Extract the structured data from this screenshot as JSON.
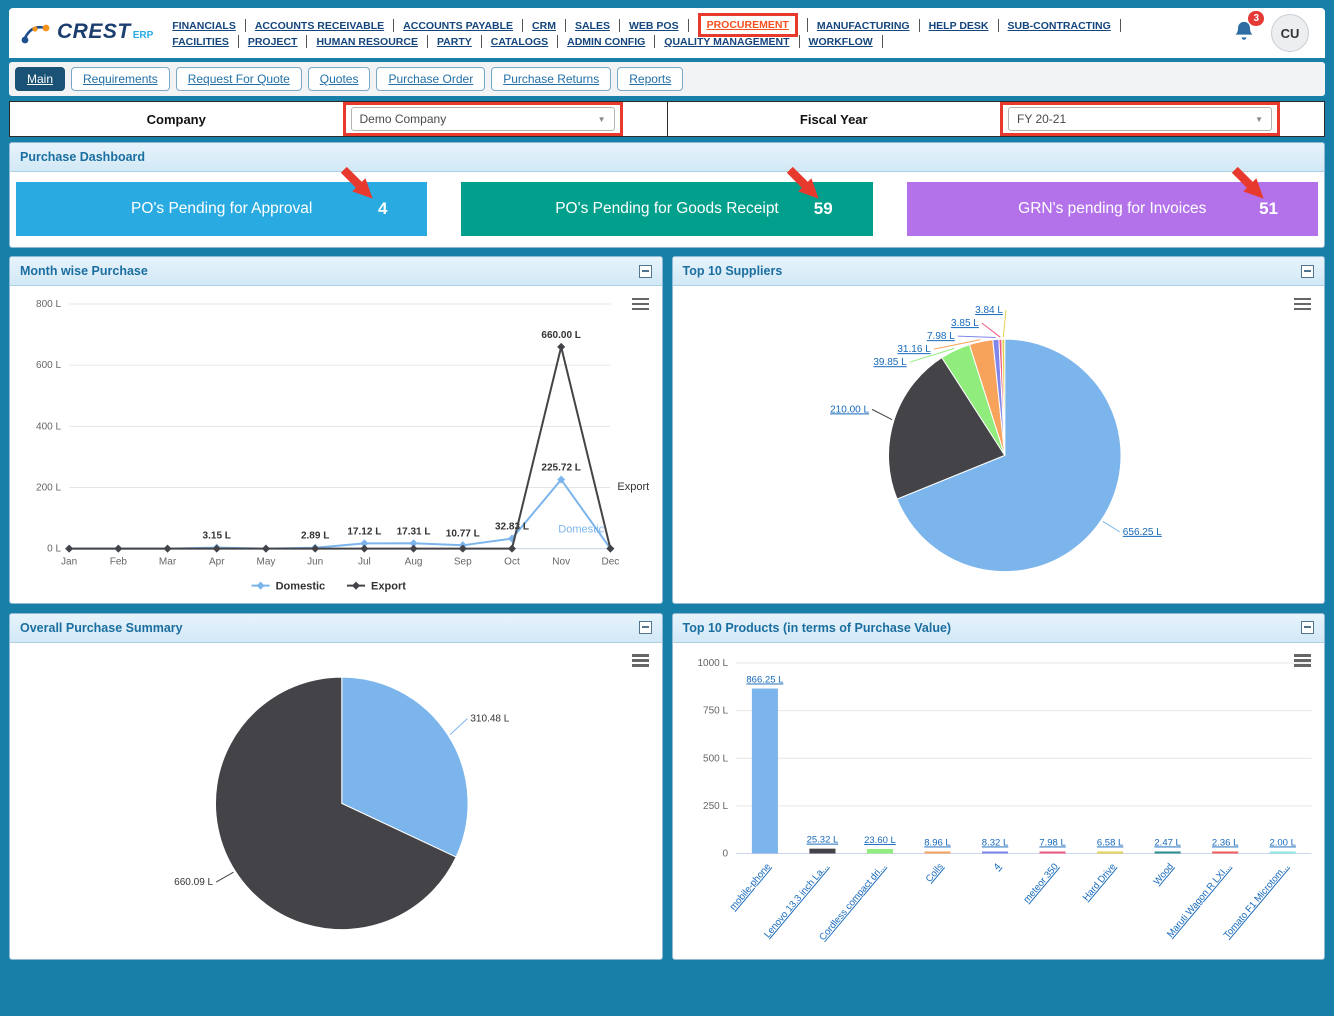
{
  "brand": {
    "name": "CREST",
    "suffix": "ERP"
  },
  "header": {
    "nav_row1": [
      {
        "label": "FINANCIALS"
      },
      {
        "label": "ACCOUNTS RECEIVABLE"
      },
      {
        "label": "ACCOUNTS PAYABLE"
      },
      {
        "label": "CRM"
      },
      {
        "label": "SALES"
      },
      {
        "label": "WEB POS"
      },
      {
        "label": "PROCUREMENT",
        "active": true,
        "highlighted": true
      },
      {
        "label": "MANUFACTURING"
      },
      {
        "label": "HELP DESK"
      },
      {
        "label": "SUB-CONTRACTING"
      }
    ],
    "nav_row2": [
      {
        "label": "FACILITIES"
      },
      {
        "label": "PROJECT"
      },
      {
        "label": "HUMAN RESOURCE"
      },
      {
        "label": "PARTY"
      },
      {
        "label": "CATALOGS"
      },
      {
        "label": "ADMIN CONFIG"
      },
      {
        "label": "QUALITY MANAGEMENT"
      },
      {
        "label": "WORKFLOW"
      }
    ],
    "notification_count": "3",
    "avatar_initials": "CU"
  },
  "tabs": [
    {
      "label": "Main",
      "active": true
    },
    {
      "label": "Requirements"
    },
    {
      "label": "Request For Quote"
    },
    {
      "label": "Quotes"
    },
    {
      "label": "Purchase Order"
    },
    {
      "label": "Purchase Returns"
    },
    {
      "label": "Reports"
    }
  ],
  "filters": {
    "company": {
      "label": "Company",
      "value": "Demo Company"
    },
    "fiscal_year": {
      "label": "Fiscal Year",
      "value": "FY 20-21"
    }
  },
  "dashboard_title": "Purchase Dashboard",
  "kpis": [
    {
      "label": "PO's Pending for Approval",
      "value": "4",
      "color": "#29abe2"
    },
    {
      "label": "PO's Pending for Goods Receipt",
      "value": "59",
      "color": "#00a08c"
    },
    {
      "label": "GRN's pending for Invoices",
      "value": "51",
      "color": "#b472ea"
    }
  ],
  "panels": {
    "month_wise": {
      "title": "Month wise Purchase"
    },
    "suppliers": {
      "title": "Top 10 Suppliers"
    },
    "summary": {
      "title": "Overall Purchase Summary"
    },
    "products": {
      "title": "Top 10 Products (in terms of Purchase Value)"
    }
  },
  "chart_data": [
    {
      "id": "month_wise",
      "type": "line",
      "title": "Month wise Purchase",
      "unit": "L",
      "categories": [
        "Jan",
        "Feb",
        "Mar",
        "Apr",
        "May",
        "Jun",
        "Jul",
        "Aug",
        "Sep",
        "Oct",
        "Nov",
        "Dec"
      ],
      "yticks": [
        "0 L",
        "200 L",
        "400 L",
        "600 L",
        "800 L"
      ],
      "ylim": [
        0,
        800
      ],
      "legend_position": "bottom",
      "series": [
        {
          "name": "Domestic",
          "color": "#7cb5ec",
          "values": [
            0,
            0,
            0,
            3.15,
            0,
            2.89,
            17.12,
            17.31,
            10.77,
            32.83,
            225.72,
            0
          ]
        },
        {
          "name": "Export",
          "color": "#434348",
          "values": [
            0,
            0,
            0,
            0,
            0,
            0,
            0,
            0,
            0,
            0,
            660.0,
            0
          ]
        }
      ]
    },
    {
      "id": "suppliers",
      "type": "pie",
      "title": "Top 10 Suppliers",
      "slices": [
        {
          "value": 656.25,
          "label": "656.25 L",
          "color": "#7cb5ec"
        },
        {
          "value": 210.0,
          "label": "210.00 L",
          "color": "#434348"
        },
        {
          "value": 39.85,
          "label": "39.85 L",
          "color": "#90ed7d"
        },
        {
          "value": 31.16,
          "label": "31.16 L",
          "color": "#f7a35c"
        },
        {
          "value": 7.98,
          "label": "7.98 L",
          "color": "#8085e9"
        },
        {
          "value": 3.85,
          "label": "3.85 L",
          "color": "#f15c80"
        },
        {
          "value": 3.84,
          "label": "3.84 L",
          "color": "#e4d354"
        }
      ]
    },
    {
      "id": "summary",
      "type": "pie",
      "title": "Overall Purchase Summary",
      "slices": [
        {
          "value": 310.48,
          "label": "310.48 L",
          "color": "#7cb5ec"
        },
        {
          "value": 660.09,
          "label": "660.09 L",
          "color": "#434348"
        }
      ]
    },
    {
      "id": "products",
      "type": "bar",
      "title": "Top 10 Products (in terms of Purchase Value)",
      "categories": [
        "mobile-phone",
        "Lenovo 13.3 inch La...",
        "Cordless compact dri...",
        "Coils",
        "4",
        "meteor 350",
        "Hard Drive",
        "Wood",
        "Maruti Wagon R LXI...",
        "Tomato F1 Microtom..."
      ],
      "values": [
        866.25,
        25.32,
        23.6,
        8.96,
        8.32,
        7.98,
        6.58,
        2.47,
        2.36,
        2.0
      ],
      "labels": [
        "866.25 L",
        "25.32 L",
        "23.60 L",
        "8.96 L",
        "8.32 L",
        "7.98 L",
        "6.58 L",
        "2.47 L",
        "2.36 L",
        "2.00 L"
      ],
      "colors": [
        "#7cb5ec",
        "#434348",
        "#90ed7d",
        "#f7a35c",
        "#8085e9",
        "#f15c80",
        "#e4d354",
        "#2b908f",
        "#f45b5b",
        "#91e8e1"
      ],
      "yticks": [
        "0",
        "250 L",
        "500 L",
        "750 L",
        "1000 L"
      ],
      "ylim": [
        0,
        1000
      ]
    }
  ]
}
